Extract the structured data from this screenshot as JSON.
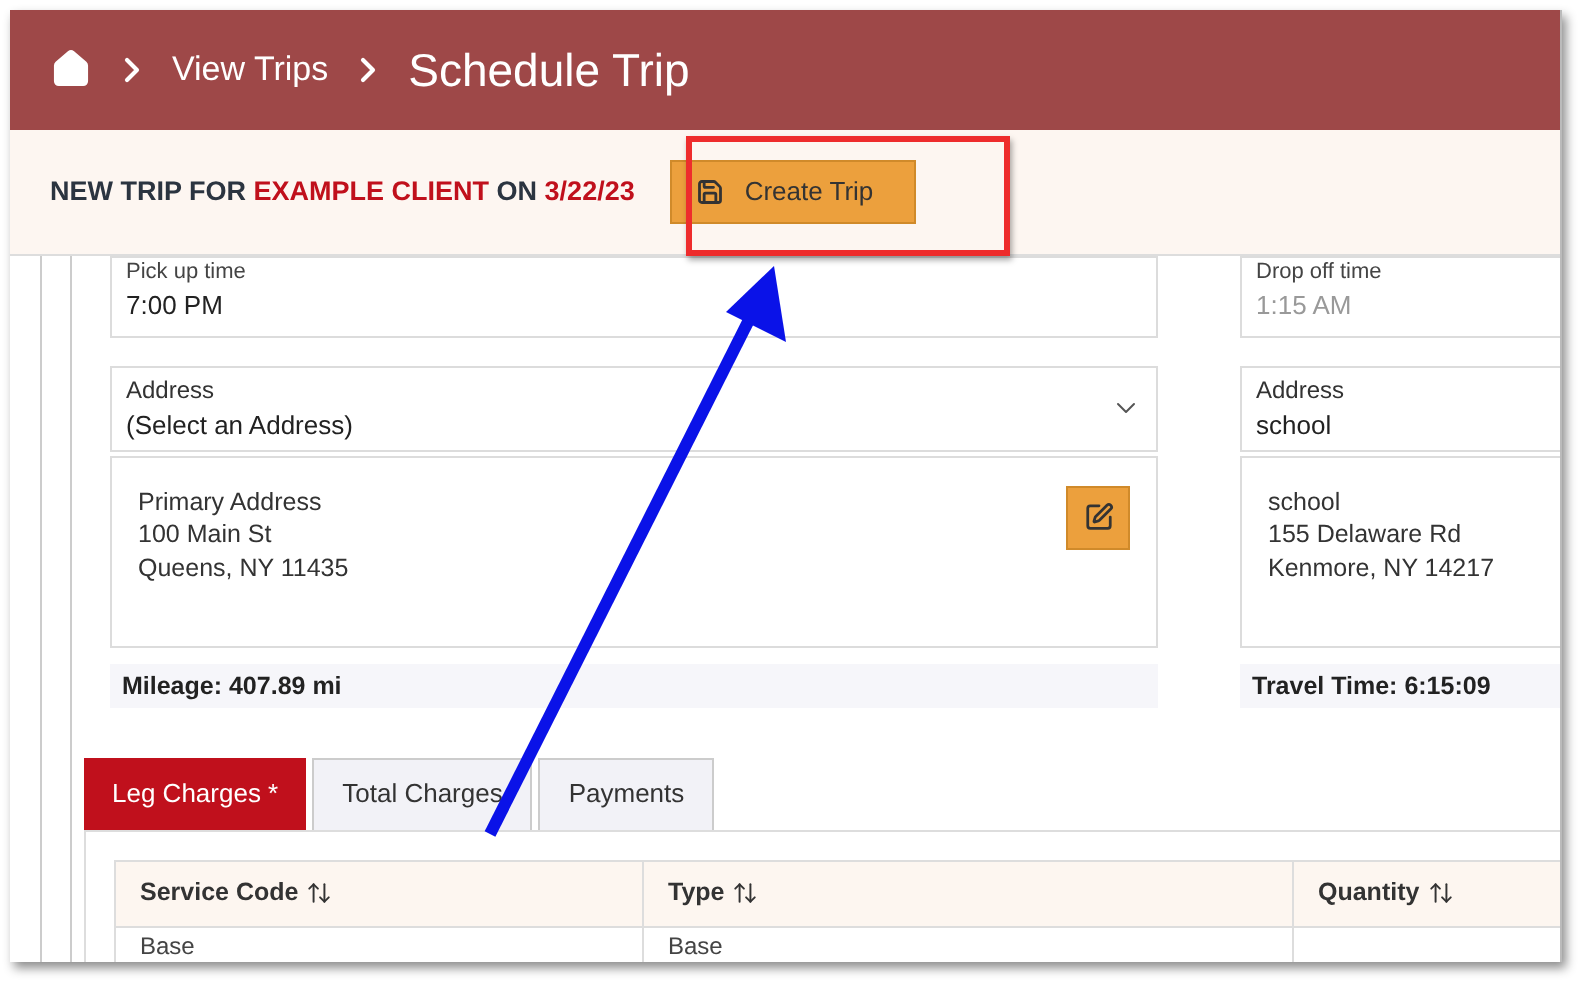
{
  "breadcrumb": {
    "items": [
      "View Trips"
    ],
    "current": "Schedule Trip"
  },
  "trip_header": {
    "parts": [
      {
        "text": "NEW TRIP FOR",
        "kind": "plain"
      },
      {
        "text": "EXAMPLE CLIENT",
        "kind": "highlight"
      },
      {
        "text": "ON",
        "kind": "plain"
      },
      {
        "text": "3/22/23",
        "kind": "highlight"
      }
    ]
  },
  "create_button": {
    "label": "Create Trip"
  },
  "pickup": {
    "time": {
      "label": "Pick up time",
      "value": "7:00 PM",
      "disabled": false
    },
    "address": {
      "label": "Address",
      "value": "(Select an Address)",
      "lines": [
        "Primary Address",
        "100 Main St",
        "Queens, NY 11435"
      ]
    },
    "summary": "Mileage: 407.89 mi"
  },
  "dropoff": {
    "time": {
      "label": "Drop off time",
      "value": "1:15 AM",
      "disabled": true
    },
    "address": {
      "label": "Address",
      "value": "school",
      "lines": [
        "school",
        "155 Delaware Rd",
        "Kenmore, NY 14217"
      ]
    },
    "summary": "Travel Time: 6:15:09"
  },
  "tabs": [
    {
      "label": "Leg Charges *",
      "selected": true
    },
    {
      "label": "Total Charges",
      "selected": false
    },
    {
      "label": "Payments",
      "selected": false
    }
  ],
  "table": {
    "columns": [
      "Service Code",
      "Type",
      "Quantity"
    ],
    "rows": [
      [
        "Base",
        "Base",
        ""
      ]
    ]
  }
}
